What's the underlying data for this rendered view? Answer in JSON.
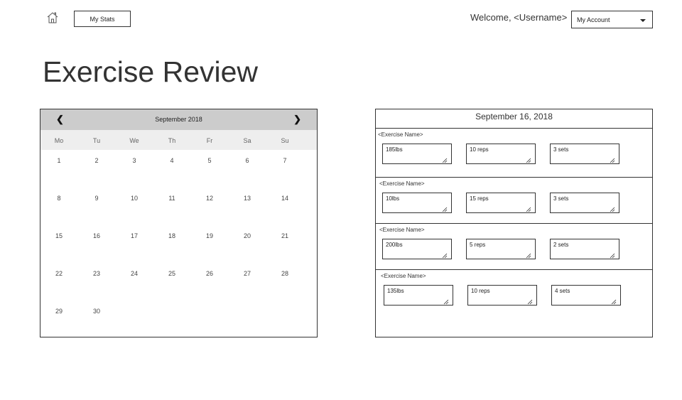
{
  "header": {
    "home_icon": "home-icon",
    "stats_label": "My Stats",
    "welcome_text": "Welcome, <Username>",
    "account_label": "My Account",
    "account_caret_icon": "chevron-down-icon"
  },
  "page": {
    "title": "Exercise Review"
  },
  "calendar": {
    "month_label": "September 2018",
    "prev_icon": "❮",
    "next_icon": "❯",
    "weekdays": [
      "Mo",
      "Tu",
      "We",
      "Th",
      "Fr",
      "Sa",
      "Su"
    ],
    "weeks": [
      [
        "1",
        "2",
        "3",
        "4",
        "5",
        "6",
        "7"
      ],
      [
        "8",
        "9",
        "10",
        "11",
        "12",
        "13",
        "14"
      ],
      [
        "15",
        "16",
        "17",
        "18",
        "19",
        "20",
        "21"
      ],
      [
        "22",
        "23",
        "24",
        "25",
        "26",
        "27",
        "28"
      ],
      [
        "29",
        "30",
        "",
        "",
        "",
        "",
        ""
      ]
    ]
  },
  "log": {
    "date": "September 16, 2018",
    "exercises": [
      {
        "name": "<Exercise Name>",
        "weight": "185lbs",
        "reps": "10 reps",
        "sets": "3 sets"
      },
      {
        "name": "<Exercise Name>",
        "weight": "10lbs",
        "reps": "15 reps",
        "sets": "3 sets"
      },
      {
        "name": "<Exercise Name>",
        "weight": "200lbs",
        "reps": "5 reps",
        "sets": "2 sets"
      },
      {
        "name": "<Exercise Name>",
        "weight": "135lbs",
        "reps": "10 reps",
        "sets": "4 sets"
      }
    ]
  }
}
